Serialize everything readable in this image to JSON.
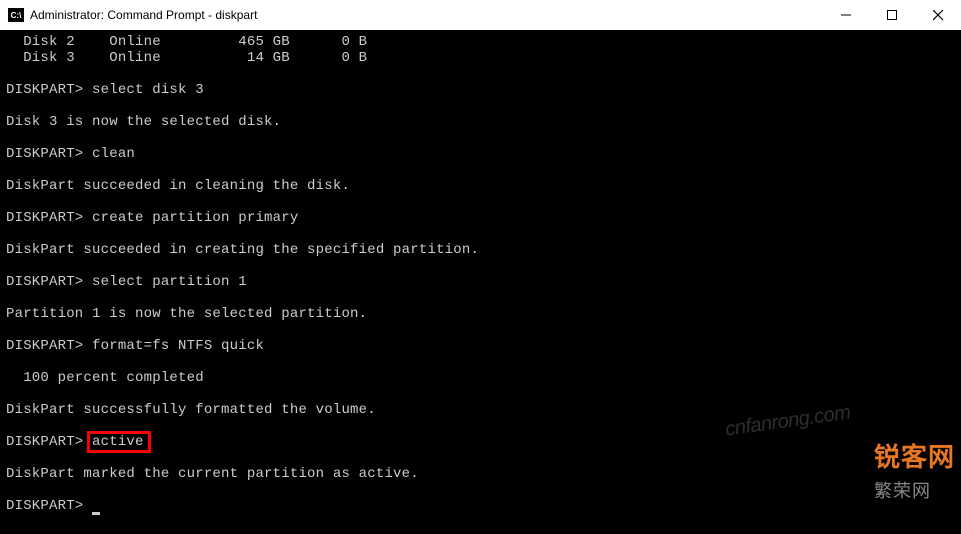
{
  "window": {
    "title": "Administrator: Command Prompt - diskpart",
    "icon_label": "C:\\"
  },
  "prompt": "DISKPART>",
  "disk_list": [
    {
      "id": "Disk 2",
      "status": "Online",
      "size": "465 GB",
      "free": "0 B"
    },
    {
      "id": "Disk 3",
      "status": "Online",
      "size": "14 GB",
      "free": "0 B"
    }
  ],
  "session": [
    {
      "type": "cmd",
      "text": "select disk 3"
    },
    {
      "type": "out",
      "text": "Disk 3 is now the selected disk."
    },
    {
      "type": "cmd",
      "text": "clean"
    },
    {
      "type": "out",
      "text": "DiskPart succeeded in cleaning the disk."
    },
    {
      "type": "cmd",
      "text": "create partition primary"
    },
    {
      "type": "out",
      "text": "DiskPart succeeded in creating the specified partition."
    },
    {
      "type": "cmd",
      "text": "select partition 1"
    },
    {
      "type": "out",
      "text": "Partition 1 is now the selected partition."
    },
    {
      "type": "cmd",
      "text": "format=fs NTFS quick"
    },
    {
      "type": "out",
      "text": "  100 percent completed"
    },
    {
      "type": "out",
      "text": "DiskPart successfully formatted the volume."
    },
    {
      "type": "cmd",
      "text": "active",
      "highlight": true
    },
    {
      "type": "out",
      "text": "DiskPart marked the current partition as active."
    },
    {
      "type": "cmd",
      "text": "",
      "cursor": true
    }
  ],
  "watermarks": {
    "url": "cnfanrong.com",
    "brand1": "锐客",
    "brand2": "网",
    "sub": "繁荣网"
  }
}
